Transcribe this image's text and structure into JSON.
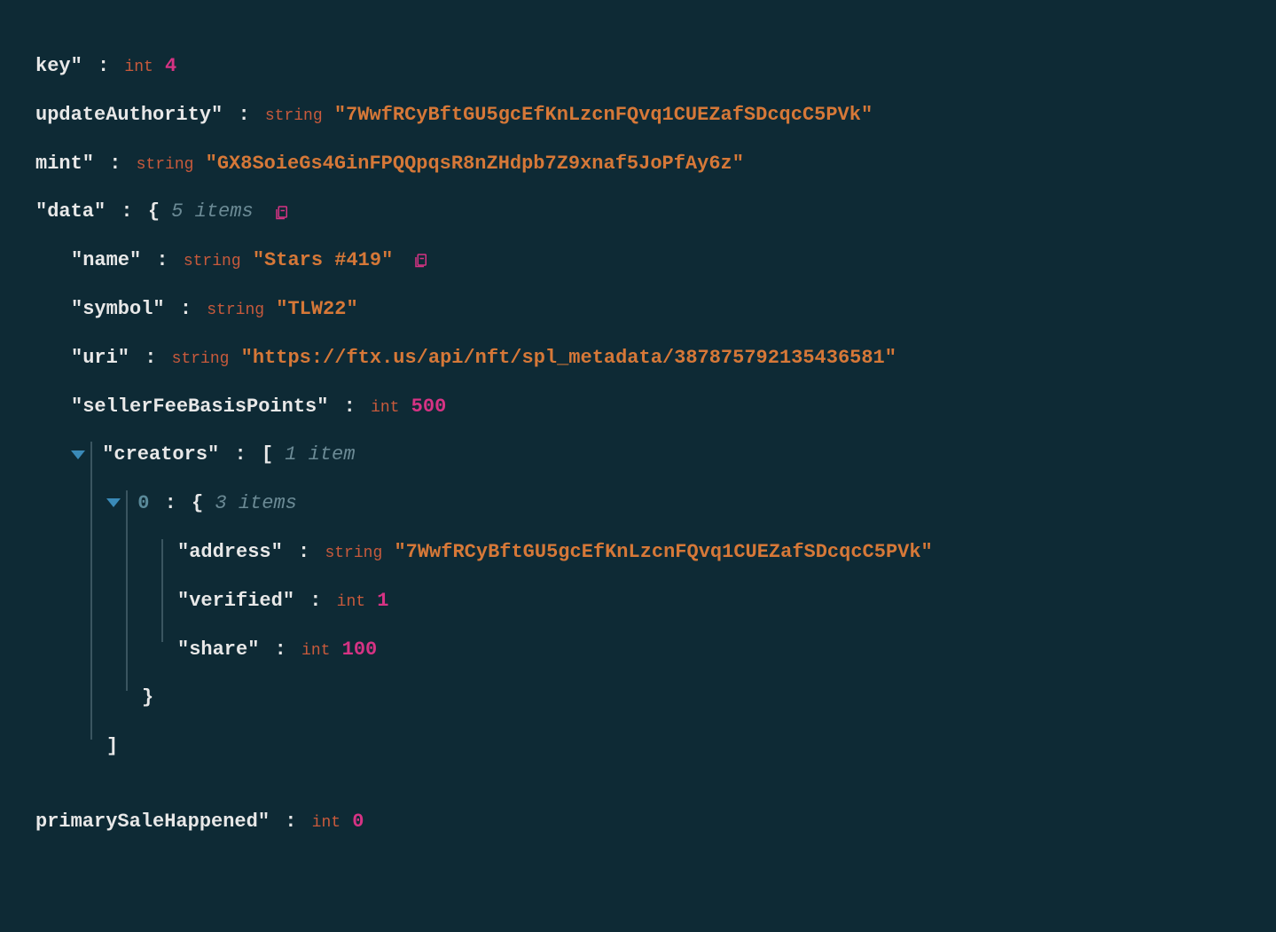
{
  "root": {
    "key": {
      "name": "key\"",
      "type": "int",
      "value": "4"
    },
    "updateAuthority": {
      "name": "updateAuthority\"",
      "type": "string",
      "value": "\"7WwfRCyBftGU5gcEfKnLzcnFQvq1CUEZafSDcqcC5PVk\""
    },
    "mint": {
      "name": "mint\"",
      "type": "string",
      "value": "\"GX8SoieGs4GinFPQQpqsR8nZHdpb7Z9xnaf5JoPfAy6z\""
    },
    "data": {
      "name": "\"data\"",
      "bracket_open": "{",
      "count": "5 items",
      "fields": {
        "name": {
          "key": "\"name\"",
          "type": "string",
          "value": "\"Stars #419\""
        },
        "symbol": {
          "key": "\"symbol\"",
          "type": "string",
          "value": "\"TLW22\""
        },
        "uri": {
          "key": "\"uri\"",
          "type": "string",
          "value": "\"https://ftx.us/api/nft/spl_metadata/387875792135436581\""
        },
        "sellerFeeBasisPoints": {
          "key": "\"sellerFeeBasisPoints\"",
          "type": "int",
          "value": "500"
        },
        "creators": {
          "key": "\"creators\"",
          "bracket_open": "[",
          "count": "1 item",
          "index0": {
            "idx": "0",
            "bracket_open": "{",
            "count": "3 items",
            "address": {
              "key": "\"address\"",
              "type": "string",
              "value": "\"7WwfRCyBftGU5gcEfKnLzcnFQvq1CUEZafSDcqcC5PVk\""
            },
            "verified": {
              "key": "\"verified\"",
              "type": "int",
              "value": "1"
            },
            "share": {
              "key": "\"share\"",
              "type": "int",
              "value": "100"
            },
            "bracket_close": "}"
          },
          "bracket_close": "]"
        }
      }
    },
    "primarySaleHappened": {
      "name": "primarySaleHappened\"",
      "type": "int",
      "value": "0"
    }
  }
}
